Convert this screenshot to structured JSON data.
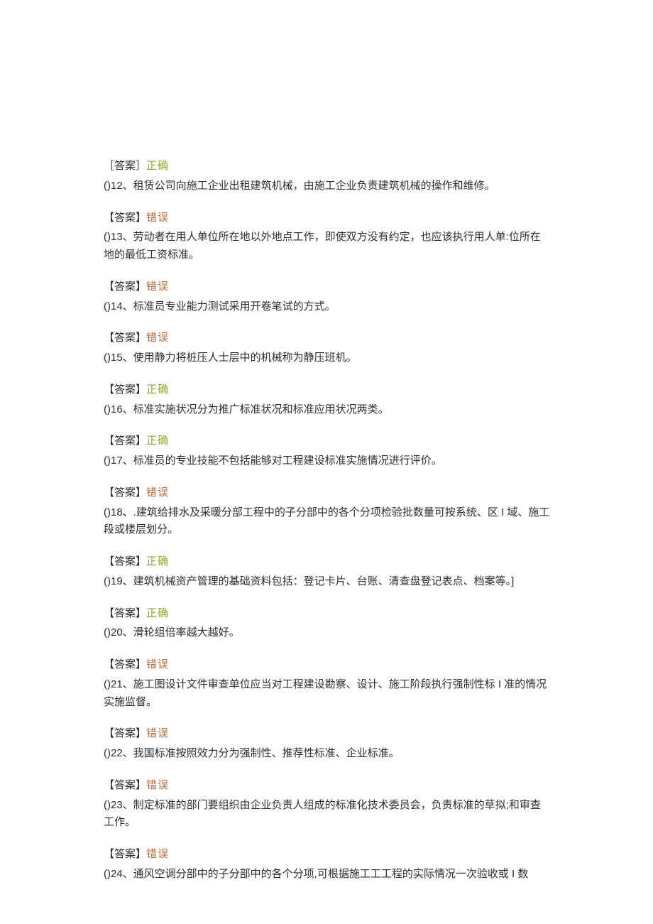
{
  "answer_label_square": "【答案】",
  "answer_label_bracket": "［答案］",
  "answer_correct": "正确",
  "answer_wrong": "错误",
  "items": [
    {
      "pre_label_style": "bracket",
      "pre_answer": "correct",
      "question": "()12、租赁公司向施工企业出租建筑机械，由施工企业负责建筑机械的操作和维修。"
    },
    {
      "pre_label_style": "square",
      "pre_answer": "wrong",
      "question": "()13、劳动者在用人单位所在地以外地点工作，即使双方没有约定，也应该执行用人单:位所在地的最低工资标准。"
    },
    {
      "pre_label_style": "square",
      "pre_answer": "wrong",
      "question": "()14、标准员专业能力测试采用开卷笔试的方式。"
    },
    {
      "pre_label_style": "square",
      "pre_answer": "wrong",
      "question": "()15、使用静力将桩压人士层中的机械称为静压班机。"
    },
    {
      "pre_label_style": "square",
      "pre_answer": "correct",
      "question": "()16、标准实施状况分为推广标准状况和标准应用状况两类。"
    },
    {
      "pre_label_style": "square",
      "pre_answer": "correct",
      "question": "()17、标准员的专业技能不包括能够对工程建设标准实施情况进行评价。"
    },
    {
      "pre_label_style": "square",
      "pre_answer": "wrong",
      "question": "()18、.建筑给排水及采暖分部工程中的子分部中的各个分项检验批数量可按系统、区 I 域、施工段或楼层划分。"
    },
    {
      "pre_label_style": "square",
      "pre_answer": "correct",
      "question": "()19、建筑机械资产管理的基础资料包括：登记卡片、台账、清查盘登记表点、档案等。]"
    },
    {
      "pre_label_style": "square",
      "pre_answer": "correct",
      "question": "()20、滑轮组倍率越大越好。"
    },
    {
      "pre_label_style": "square",
      "pre_answer": "wrong",
      "question": "()21、施工图设计文件审查单位应当对工程建设勘察、设计、施工阶段执行强制性标 I 准的情况实施监督。"
    },
    {
      "pre_label_style": "square",
      "pre_answer": "wrong",
      "question": "()22、我国标准按照效力分为强制性、推荐性标准、企业标准。"
    },
    {
      "pre_label_style": "square",
      "pre_answer": "wrong",
      "question": "()23、制定标准的部门要组织由企业负责人组成的标准化技术委员会，负责标准的草拟;和审查工作。"
    },
    {
      "pre_label_style": "square",
      "pre_answer": "wrong",
      "question": "()24、通风空调分部中的子分部中的各个分项,可根据施工工工程的实际情况一次验收或 I 数"
    }
  ]
}
